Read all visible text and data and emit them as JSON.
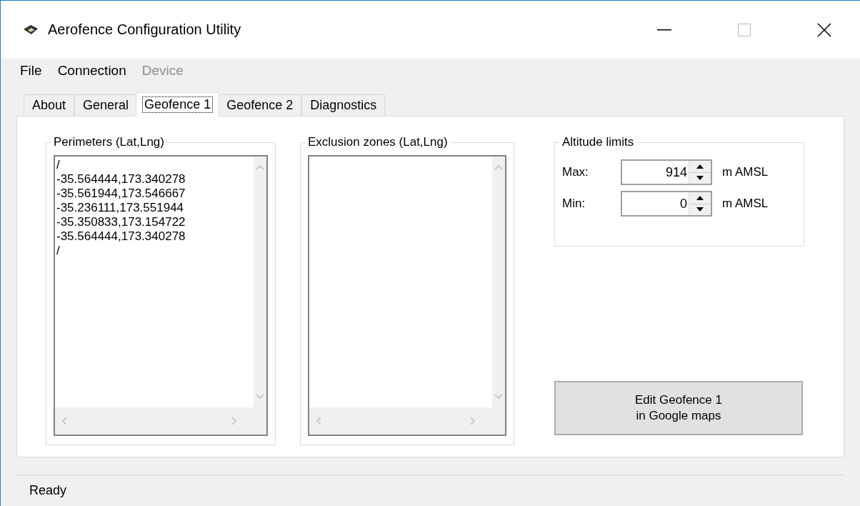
{
  "window": {
    "title": "Aerofence Configuration Utility"
  },
  "menu": [
    {
      "label": "File",
      "disabled": false
    },
    {
      "label": "Connection",
      "disabled": false
    },
    {
      "label": "Device",
      "disabled": true
    }
  ],
  "tabs": [
    {
      "label": "About",
      "selected": false
    },
    {
      "label": "General",
      "selected": false
    },
    {
      "label": "Geofence 1",
      "selected": true
    },
    {
      "label": "Geofence 2",
      "selected": false
    },
    {
      "label": "Diagnostics",
      "selected": false
    }
  ],
  "perimeters": {
    "title": "Perimeters (Lat,Lng)",
    "lines": [
      "/",
      "-35.564444,173.340278",
      "-35.561944,173.546667",
      "-35.236111,173.551944",
      "-35.350833,173.154722",
      "-35.564444,173.340278",
      "/"
    ]
  },
  "exclusion_zones": {
    "title": "Exclusion zones (Lat,Lng)"
  },
  "altitude_limits": {
    "title": "Altitude limits",
    "rows": [
      {
        "label": "Max:",
        "value": "914",
        "unit": "m AMSL"
      },
      {
        "label": "Min:",
        "value": "0",
        "unit": "m AMSL"
      }
    ]
  },
  "edit_button": {
    "lines": [
      "Edit Geofence 1",
      "in Google maps"
    ]
  },
  "status_bar": {
    "text": "Ready"
  }
}
